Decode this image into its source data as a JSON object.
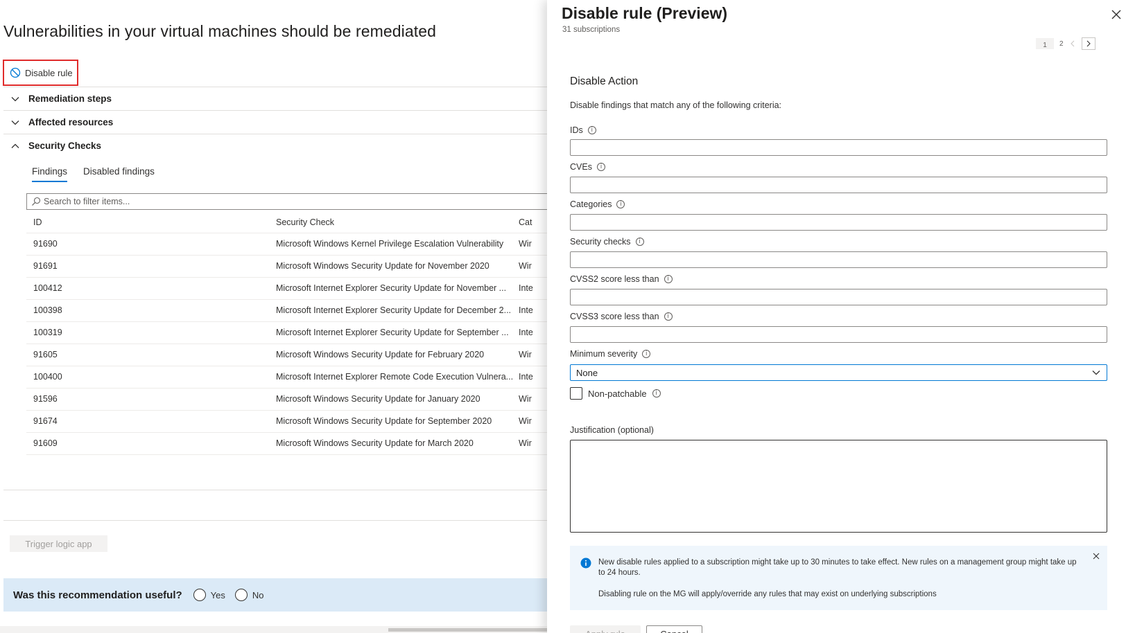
{
  "page": {
    "title": "Vulnerabilities in your virtual machines should be remediated",
    "disable_rule_label": "Disable rule",
    "sections": [
      {
        "label": "Remediation steps",
        "expanded": false
      },
      {
        "label": "Affected resources",
        "expanded": false
      },
      {
        "label": "Security Checks",
        "expanded": true
      }
    ],
    "tabs": [
      {
        "label": "Findings",
        "active": true
      },
      {
        "label": "Disabled findings",
        "active": false
      }
    ],
    "search_placeholder": "Search to filter items...",
    "table": {
      "columns": [
        "ID",
        "Security Check",
        "Cat"
      ],
      "rows": [
        {
          "id": "91690",
          "check": "Microsoft Windows Kernel Privilege Escalation Vulnerability",
          "cat": "Wir"
        },
        {
          "id": "91691",
          "check": "Microsoft Windows Security Update for November 2020",
          "cat": "Wir"
        },
        {
          "id": "100412",
          "check": "Microsoft Internet Explorer Security Update for November ...",
          "cat": "Inte"
        },
        {
          "id": "100398",
          "check": "Microsoft Internet Explorer Security Update for December 2...",
          "cat": "Inte"
        },
        {
          "id": "100319",
          "check": "Microsoft Internet Explorer Security Update for September ...",
          "cat": "Inte"
        },
        {
          "id": "91605",
          "check": "Microsoft Windows Security Update for February 2020",
          "cat": "Wir"
        },
        {
          "id": "100400",
          "check": "Microsoft Internet Explorer Remote Code Execution Vulnera...",
          "cat": "Inte"
        },
        {
          "id": "91596",
          "check": "Microsoft Windows Security Update for January 2020",
          "cat": "Wir"
        },
        {
          "id": "91674",
          "check": "Microsoft Windows Security Update for September 2020",
          "cat": "Wir"
        },
        {
          "id": "91609",
          "check": "Microsoft Windows Security Update for March 2020",
          "cat": "Wir"
        }
      ]
    },
    "trigger_label": "Trigger logic app",
    "feedback": {
      "question": "Was this recommendation useful?",
      "yes": "Yes",
      "no": "No"
    }
  },
  "panel": {
    "title": "Disable rule (Preview)",
    "subtitle": "31 subscriptions",
    "pager": {
      "page1": "1",
      "page2": "2"
    },
    "section_heading": "Disable Action",
    "description": "Disable findings that match any of the following criteria:",
    "fields": {
      "ids": {
        "label": "IDs",
        "value": ""
      },
      "cves": {
        "label": "CVEs",
        "value": ""
      },
      "categories": {
        "label": "Categories",
        "value": ""
      },
      "security_checks": {
        "label": "Security checks",
        "value": ""
      },
      "cvss2": {
        "label": "CVSS2 score less than",
        "value": ""
      },
      "cvss3": {
        "label": "CVSS3 score less than",
        "value": ""
      },
      "min_severity": {
        "label": "Minimum severity",
        "value": "None"
      },
      "non_patchable": {
        "label": "Non-patchable",
        "checked": false
      },
      "justification": {
        "label": "Justification (optional)",
        "value": ""
      }
    },
    "info": {
      "message": "New disable rules applied to a subscription might take up to 30 minutes to take effect. New rules on a management group might take up to 24 hours.",
      "message2": "Disabling rule on the MG will apply/override any rules that may exist on underlying subscriptions"
    },
    "apply_label": "Apply rule",
    "cancel_label": "Cancel"
  },
  "colors": {
    "accent": "#0078d4",
    "highlight_border": "#e02b2b",
    "info_bg": "#eff6fc",
    "feedback_bg": "#dbeaf7"
  },
  "icons": [
    "block-icon",
    "chevron-down-icon",
    "chevron-up-icon",
    "search-icon",
    "close-icon",
    "info-icon",
    "info-filled-icon",
    "chevron-left-icon",
    "chevron-right-icon"
  ]
}
